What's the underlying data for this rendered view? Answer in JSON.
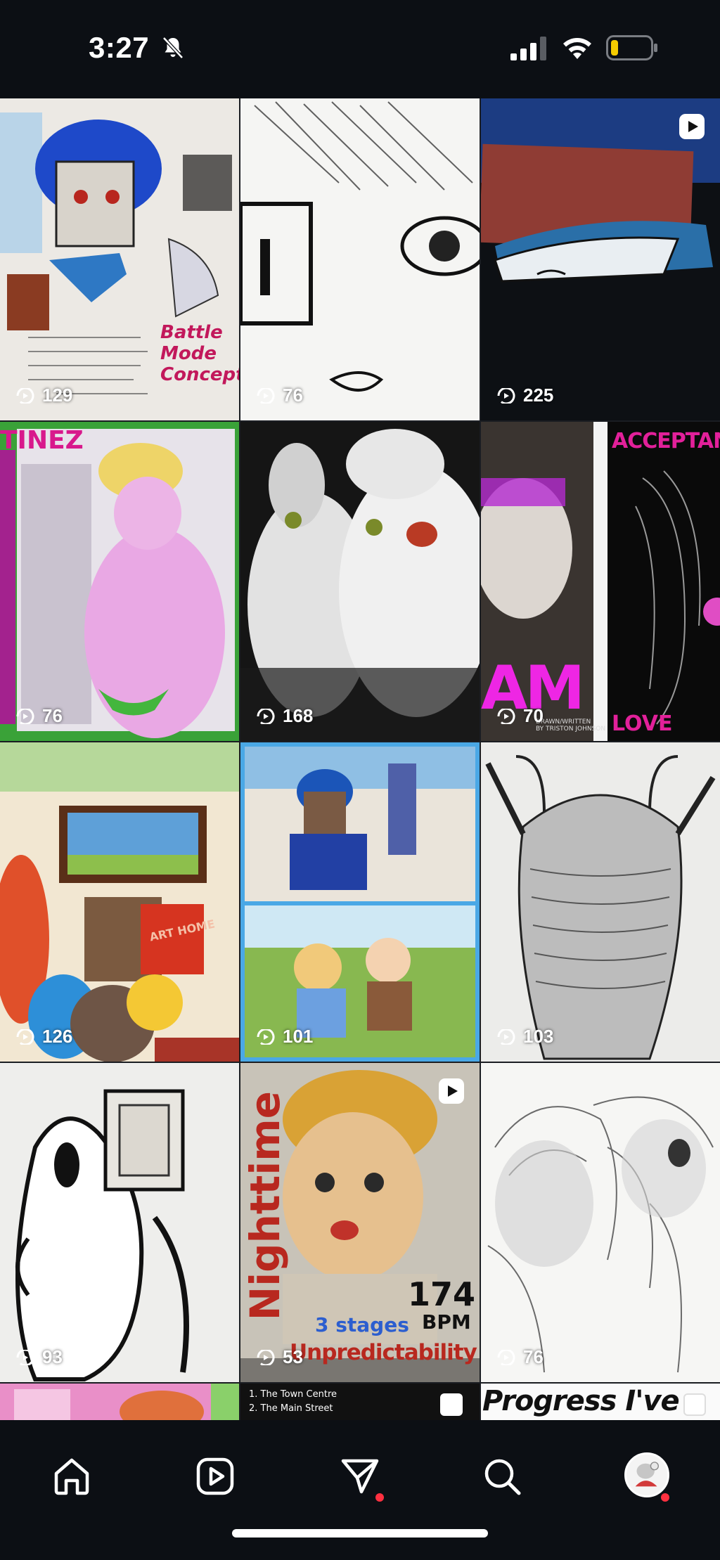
{
  "status_bar": {
    "time": "3:27",
    "icons": [
      "bell-slash-icon",
      "signal-icon",
      "wifi-icon",
      "battery-icon"
    ],
    "battery_level": 0.15
  },
  "grid": {
    "posts": [
      {
        "id": "post-1",
        "views": "129",
        "is_reel": false,
        "overlay": [
          "Battle",
          "Mode",
          "Concept"
        ]
      },
      {
        "id": "post-2",
        "views": "76",
        "is_reel": false,
        "overlay": []
      },
      {
        "id": "post-3",
        "views": "225",
        "is_reel": true,
        "overlay": []
      },
      {
        "id": "post-4",
        "views": "76",
        "is_reel": false,
        "overlay": [
          "TINEZ"
        ]
      },
      {
        "id": "post-5",
        "views": "168",
        "is_reel": false,
        "overlay": []
      },
      {
        "id": "post-6",
        "views": "70",
        "is_reel": false,
        "overlay": [
          "ACCEPTANCE",
          "AM",
          "DRAWN/WRITTEN",
          "BY TRISTON JOHNSON",
          "LOVE"
        ]
      },
      {
        "id": "post-7",
        "views": "126",
        "is_reel": false,
        "overlay": [
          "ART HOME"
        ]
      },
      {
        "id": "post-8",
        "views": "101",
        "is_reel": false,
        "overlay": []
      },
      {
        "id": "post-9",
        "views": "103",
        "is_reel": false,
        "overlay": []
      },
      {
        "id": "post-10",
        "views": "93",
        "is_reel": false,
        "overlay": []
      },
      {
        "id": "post-11",
        "views": "53",
        "is_reel": true,
        "overlay": [
          "Nighttime",
          "174",
          "BPM",
          "3 stages",
          "Unpredictability"
        ]
      },
      {
        "id": "post-12",
        "views": "76",
        "is_reel": false,
        "overlay": []
      },
      {
        "id": "post-13",
        "views": "",
        "is_reel": false,
        "overlay": []
      },
      {
        "id": "post-14",
        "views": "",
        "is_reel": false,
        "overlay": [
          "1.  The Town Centre",
          "2.  The Main Street"
        ]
      },
      {
        "id": "post-15",
        "views": "",
        "is_reel": false,
        "overlay": [
          "Progress I've"
        ]
      }
    ]
  },
  "bottom_nav": {
    "items": [
      "home-icon",
      "reels-icon",
      "messages-icon",
      "search-icon",
      "profile-avatar"
    ],
    "accent": "#ff3040"
  }
}
